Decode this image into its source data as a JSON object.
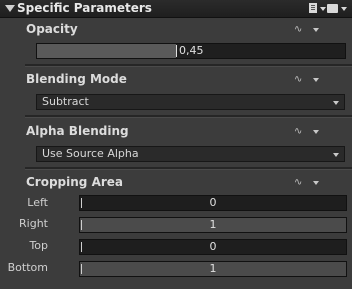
{
  "header": {
    "title": "Specific Parameters"
  },
  "opacity": {
    "label": "Opacity",
    "value_text": "0,45",
    "value": 0.45
  },
  "blending_mode": {
    "label": "Blending Mode",
    "selected": "Subtract"
  },
  "alpha_blending": {
    "label": "Alpha Blending",
    "selected": "Use Source Alpha"
  },
  "cropping": {
    "label": "Cropping Area",
    "fields": [
      {
        "label": "Left",
        "value": "0"
      },
      {
        "label": "Right",
        "value": "1"
      },
      {
        "label": "Top",
        "value": "0"
      },
      {
        "label": "Bottom",
        "value": "1"
      }
    ]
  },
  "icons": {
    "collapse": "triangle-down-icon",
    "document": "document-icon",
    "folder": "folder-icon",
    "animate": "animation-curve-icon",
    "menu": "chevron-down-icon"
  }
}
